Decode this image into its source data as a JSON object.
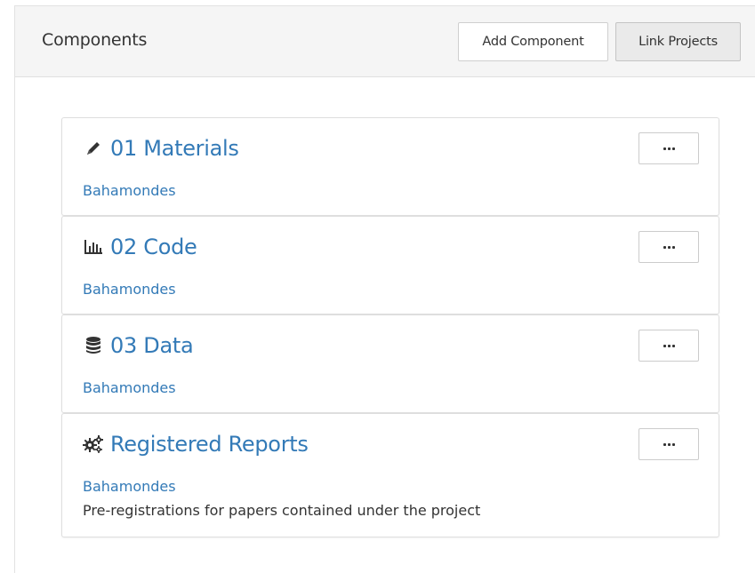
{
  "header": {
    "title": "Components",
    "add_component_label": "Add Component",
    "link_projects_label": "Link Projects"
  },
  "components": [
    {
      "icon": "pencil-icon",
      "title": "01 Materials",
      "author": "Bahamondes",
      "description": ""
    },
    {
      "icon": "bar-chart-icon",
      "title": "02 Code",
      "author": "Bahamondes",
      "description": ""
    },
    {
      "icon": "database-icon",
      "title": "03 Data",
      "author": "Bahamondes",
      "description": ""
    },
    {
      "icon": "gears-icon",
      "title": "Registered Reports",
      "author": "Bahamondes",
      "description": "Pre-registrations for papers contained under the project"
    }
  ],
  "colors": {
    "link": "#337ab7",
    "text": "#333333",
    "header_bg": "#f5f5f5"
  }
}
